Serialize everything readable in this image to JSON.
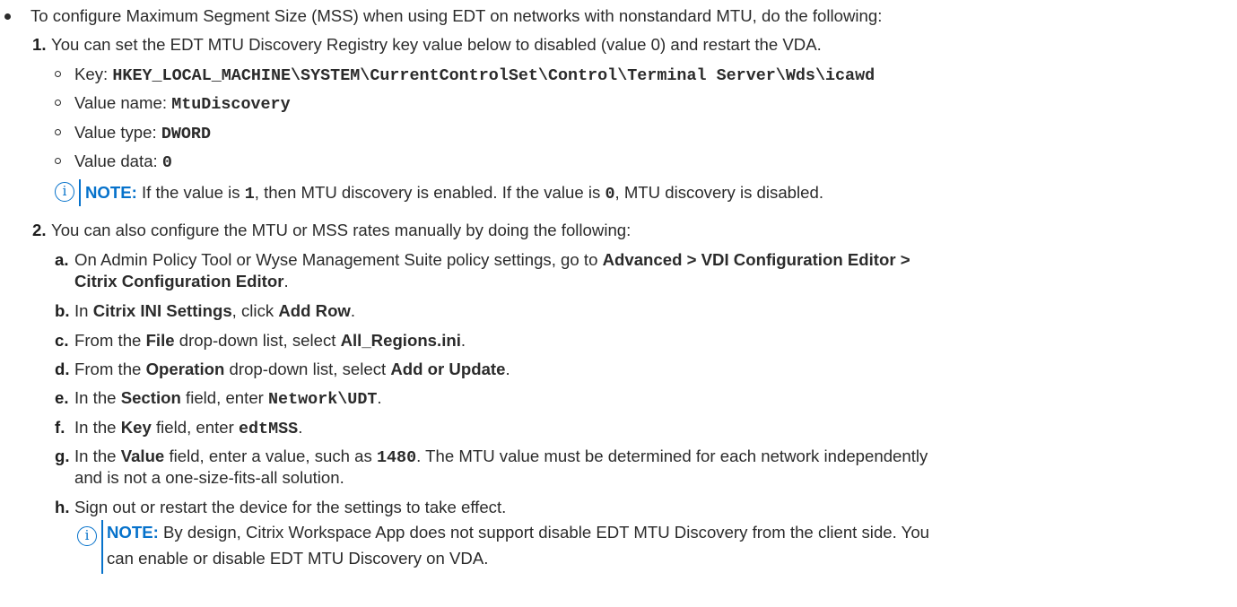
{
  "intro": "To configure Maximum Segment Size (MSS) when using EDT on networks with nonstandard MTU, do the following:",
  "step1": {
    "marker": "1.",
    "text": "You can set the EDT MTU Discovery Registry key value below to disabled (value 0) and restart the VDA.",
    "key_label": "Key: ",
    "key_value": "HKEY_LOCAL_MACHINE\\SYSTEM\\CurrentControlSet\\Control\\Terminal Server\\Wds\\icawd",
    "name_label": "Value name: ",
    "name_value": "MtuDiscovery",
    "type_label": "Value type: ",
    "type_value": "DWORD",
    "data_label": "Value data: ",
    "data_value": "0",
    "note": {
      "label": "NOTE:",
      "t1": " If the value is ",
      "v1": "1",
      "t2": ", then MTU discovery is enabled. If the value is ",
      "v2": "0",
      "t3": ", MTU discovery is disabled."
    }
  },
  "step2": {
    "marker": "2.",
    "text": "You can also configure the MTU or MSS rates manually by doing the following:",
    "a": {
      "marker": "a.",
      "t1": "On Admin Policy Tool or Wyse Management Suite policy settings, go to ",
      "b1": "Advanced > VDI Configuration Editor >",
      "b2": "Citrix Configuration Editor",
      "t2": "."
    },
    "b": {
      "marker": "b.",
      "t1": "In ",
      "b1": "Citrix INI Settings",
      "t2": ", click ",
      "b2": "Add Row",
      "t3": "."
    },
    "c": {
      "marker": "c.",
      "t1": "From the ",
      "b1": "File",
      "t2": " drop-down list, select ",
      "b2": "All_Regions.ini",
      "t3": "."
    },
    "d": {
      "marker": "d.",
      "t1": "From the ",
      "b1": "Operation",
      "t2": " drop-down list, select ",
      "b2": "Add or Update",
      "t3": "."
    },
    "e": {
      "marker": "e.",
      "t1": "In the ",
      "b1": "Section",
      "t2": " field, enter ",
      "m1": "Network\\UDT",
      "t3": "."
    },
    "f": {
      "marker": "f.",
      "t1": "In the ",
      "b1": "Key",
      "t2": " field, enter ",
      "m1": "edtMSS",
      "t3": "."
    },
    "g": {
      "marker": "g.",
      "t1": "In the ",
      "b1": "Value",
      "t2": " field, enter a value, such as ",
      "m1": "1480",
      "t3": ". The MTU value must be determined for each network independently",
      "t4": "and is not a one-size-fits-all solution."
    },
    "h": {
      "marker": "h.",
      "text": "Sign out or restart the device for the settings to take effect.",
      "note": {
        "label": "NOTE:",
        "line1": " By design, Citrix Workspace App does not support disable EDT MTU Discovery from the client side. You",
        "line2": "can enable or disable EDT MTU Discovery on VDA."
      }
    }
  }
}
